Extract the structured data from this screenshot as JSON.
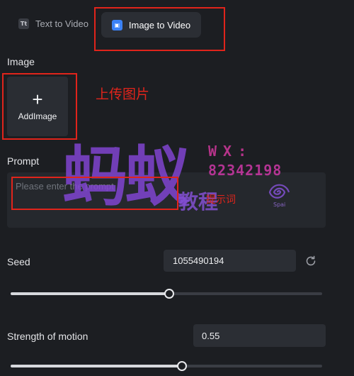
{
  "tabs": [
    {
      "icon": "Tt",
      "label": "Text to Video",
      "active": false
    },
    {
      "icon": "▣",
      "label": "Image to Video",
      "active": true
    }
  ],
  "image_section": {
    "label": "Image",
    "upload_icon": "+",
    "upload_label": "AddImage"
  },
  "prompt_section": {
    "label": "Prompt",
    "placeholder": "Please enter the prompt"
  },
  "seed_section": {
    "label": "Seed",
    "value": "1055490194",
    "slider_level": 0.51
  },
  "motion_section": {
    "label": "Strength of motion",
    "value": "0.55",
    "slider_level": 0.55
  },
  "annotations": {
    "upload_note": "上传图片",
    "prompt_note": "提示词"
  },
  "watermark": {
    "main": "蚂蚁",
    "wx": "WX:",
    "number": "82342198",
    "sub": "教程",
    "logo_text": "Spai"
  },
  "colors": {
    "background": "#1c1e22",
    "accent": "#3b82f6",
    "annotation_red": "#e0241b"
  }
}
